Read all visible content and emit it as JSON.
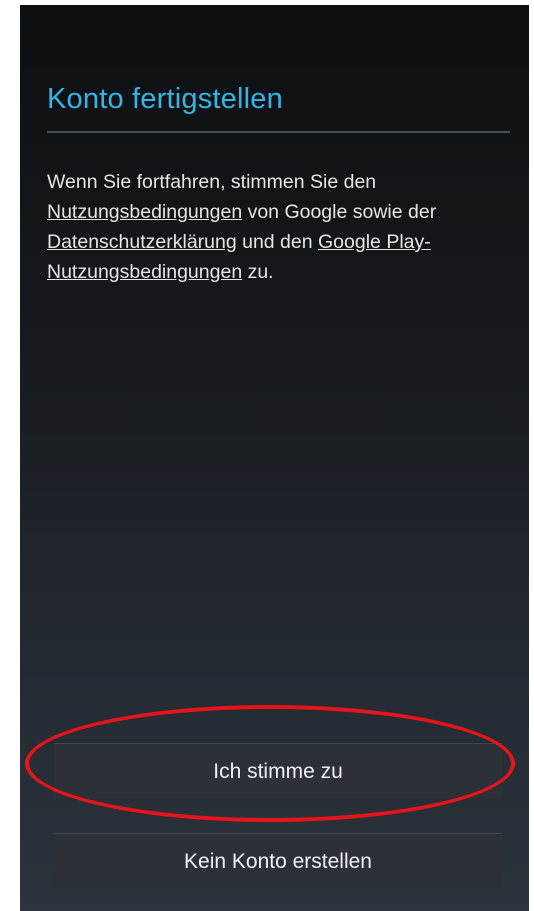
{
  "dialog": {
    "title": "Konto fertigstellen",
    "text": {
      "part1": "Wenn Sie fortfahren, stimmen Sie den ",
      "link_terms": "Nutzungsbedingungen",
      "part2": " von Google sowie der ",
      "link_privacy": "Datenschutzerklärung",
      "part3": " und den ",
      "link_play_terms": "Google Play-Nutzungsbedingungen",
      "part4": " zu."
    },
    "buttons": {
      "agree_label": "Ich stimme zu",
      "skip_label": "Kein Konto erstellen"
    }
  },
  "annotation": {
    "highlight_color": "#e8141b"
  },
  "colors": {
    "title": "#33b5e5",
    "background_top": "#0d0f11",
    "background_bottom": "#2c333a",
    "text": "#e6e6e6"
  }
}
